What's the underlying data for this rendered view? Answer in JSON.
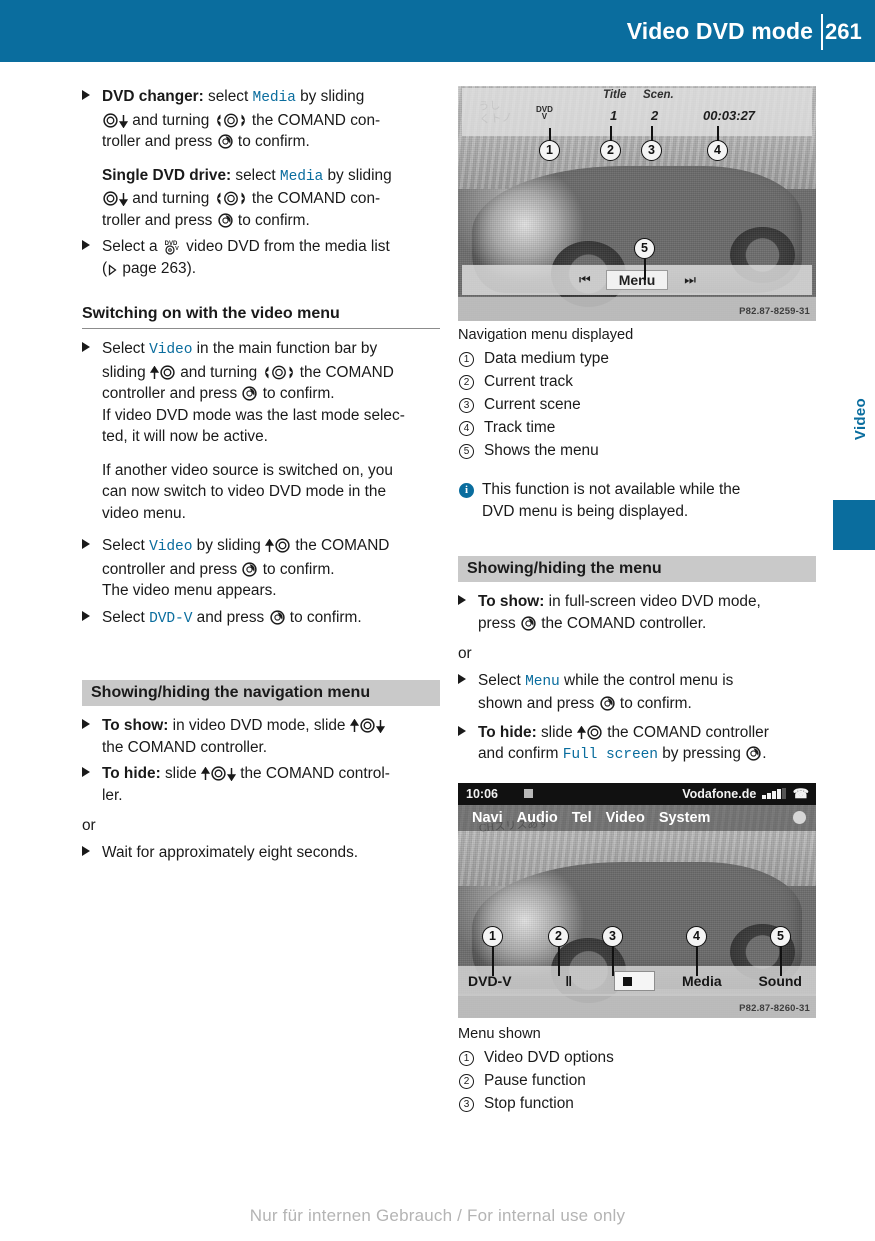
{
  "header": {
    "title": "Video DVD mode",
    "page_number": "261"
  },
  "side_tab": {
    "label": "Video"
  },
  "colors": {
    "accent_blue": "#0a6d9e",
    "heading_grey": "#c9c9c9",
    "command_text": "#0a6d9e"
  },
  "left_column": {
    "items": [
      {
        "lead_bold": "DVD changer:",
        "text_1": " select ",
        "cmd_1": "Media",
        "text_2": " by sliding",
        "line2_a": " and turning ",
        "line2_b": " the COMAND con-",
        "line3": "troller and press ",
        "line3_b": " to confirm."
      },
      {
        "lead_bold": "Single DVD drive:",
        "text_1": " select ",
        "cmd_1": "Media",
        "text_2": " by sliding",
        "line2_a": " and turning ",
        "line2_b": " the COMAND con-",
        "line3": "troller and press ",
        "line3_b": " to confirm."
      },
      {
        "text_1": "Select a ",
        "icon_label": "DVD-V",
        "text_2": " video DVD from the media list",
        "text_3": "page 263)."
      }
    ],
    "heading_video_menu": "Switching on with the video menu",
    "video_menu_steps": {
      "step1_a": "Select ",
      "step1_cmd": "Video",
      "step1_b": " in the main function bar by",
      "step1_c": "sliding ",
      "step1_d": " and turning ",
      "step1_e": " the COMAND",
      "step1_f": "controller and press ",
      "step1_g": " to confirm.",
      "note1": "If video DVD mode was the last mode selec-",
      "note1_b": "ted, it will now be active.",
      "note2": "If another video source is switched on, you",
      "note2_b": "can now switch to video DVD mode in the",
      "note2_c": "video menu.",
      "step2_a": "Select ",
      "step2_cmd": "Video",
      "step2_b": " by sliding ",
      "step2_c": " the COMAND",
      "step2_d": "controller and press ",
      "step2_e": " to confirm.",
      "note3": "The video menu appears.",
      "step3_a": "Select ",
      "step3_cmd": "DVD-V",
      "step3_b": " and press ",
      "step3_c": " to confirm."
    },
    "heading_nav_menu": "Showing/hiding the navigation menu",
    "nav_menu_steps": {
      "show_bold": "To show:",
      "show_a": " in video DVD mode, slide ",
      "show_b": "the COMAND controller.",
      "hide_bold": "To hide:",
      "hide_a": " slide ",
      "hide_b": " the COMAND control-",
      "hide_c": "ler.",
      "or": "or",
      "wait": "Wait for approximately eight seconds."
    }
  },
  "right_column": {
    "shot_nav": {
      "col_head_title": "Title",
      "col_head_scene": "Scen.",
      "value_title": "1",
      "value_scene": "2",
      "value_time": "00:03:27",
      "media_icon_top": "DVD",
      "media_icon_bottom": "V",
      "prev_icon": "⏮",
      "next_icon": "⏭",
      "menu_button": "Menu",
      "scrawl": "うし\nくトノ",
      "image_id": "P82.87-8259-31",
      "callouts": [
        "1",
        "2",
        "3",
        "4",
        "5"
      ]
    },
    "legend_nav": {
      "caption": "Navigation menu displayed",
      "rows": [
        {
          "num": "1",
          "label": "Data medium type"
        },
        {
          "num": "2",
          "label": "Current track"
        },
        {
          "num": "3",
          "label": "Current scene"
        },
        {
          "num": "4",
          "label": "Track time"
        },
        {
          "num": "5",
          "label": "Shows the menu"
        }
      ]
    },
    "note": {
      "icon": "i",
      "line1": "This function is not available while the",
      "line2": "DVD menu is being displayed."
    },
    "heading_menu": "Showing/hiding the menu",
    "menu_steps": {
      "show_bold": "To show:",
      "show_a": " in full-screen video DVD mode,",
      "show_b": "press ",
      "show_c": " the COMAND controller.",
      "or": "or",
      "sel_a": "Select ",
      "sel_cmd": "Menu",
      "sel_b": " while the control menu is",
      "sel_c": "shown and press ",
      "sel_d": " to confirm.",
      "hide_bold": "To hide:",
      "hide_a": " slide ",
      "hide_b": " the COMAND controller",
      "hide_c": "and confirm ",
      "hide_cmd": "Full screen",
      "hide_d": " by pressing ",
      "hide_e": "."
    },
    "shot_menu": {
      "clock": "10:06",
      "carrier": "Vodafone.de",
      "menu_items": [
        "Navi",
        "Audio",
        "Tel",
        "Video",
        "System"
      ],
      "bottom_items": [
        "DVD-V",
        "‖",
        "■",
        "Media",
        "Sound"
      ],
      "bottom_label_1": "DVD-V",
      "bottom_label_4": "Media",
      "bottom_label_5": "Sound",
      "scrawl": "CHスリスあす",
      "image_id": "P82.87-8260-31",
      "callouts": [
        "1",
        "2",
        "3",
        "4",
        "5"
      ]
    },
    "legend_menu": {
      "caption": "Menu shown",
      "rows": [
        {
          "num": "1",
          "label": "Video DVD options"
        },
        {
          "num": "2",
          "label": "Pause function"
        },
        {
          "num": "3",
          "label": "Stop function"
        }
      ]
    }
  },
  "footer": {
    "watermark": "Nur für internen Gebrauch / For internal use only"
  }
}
